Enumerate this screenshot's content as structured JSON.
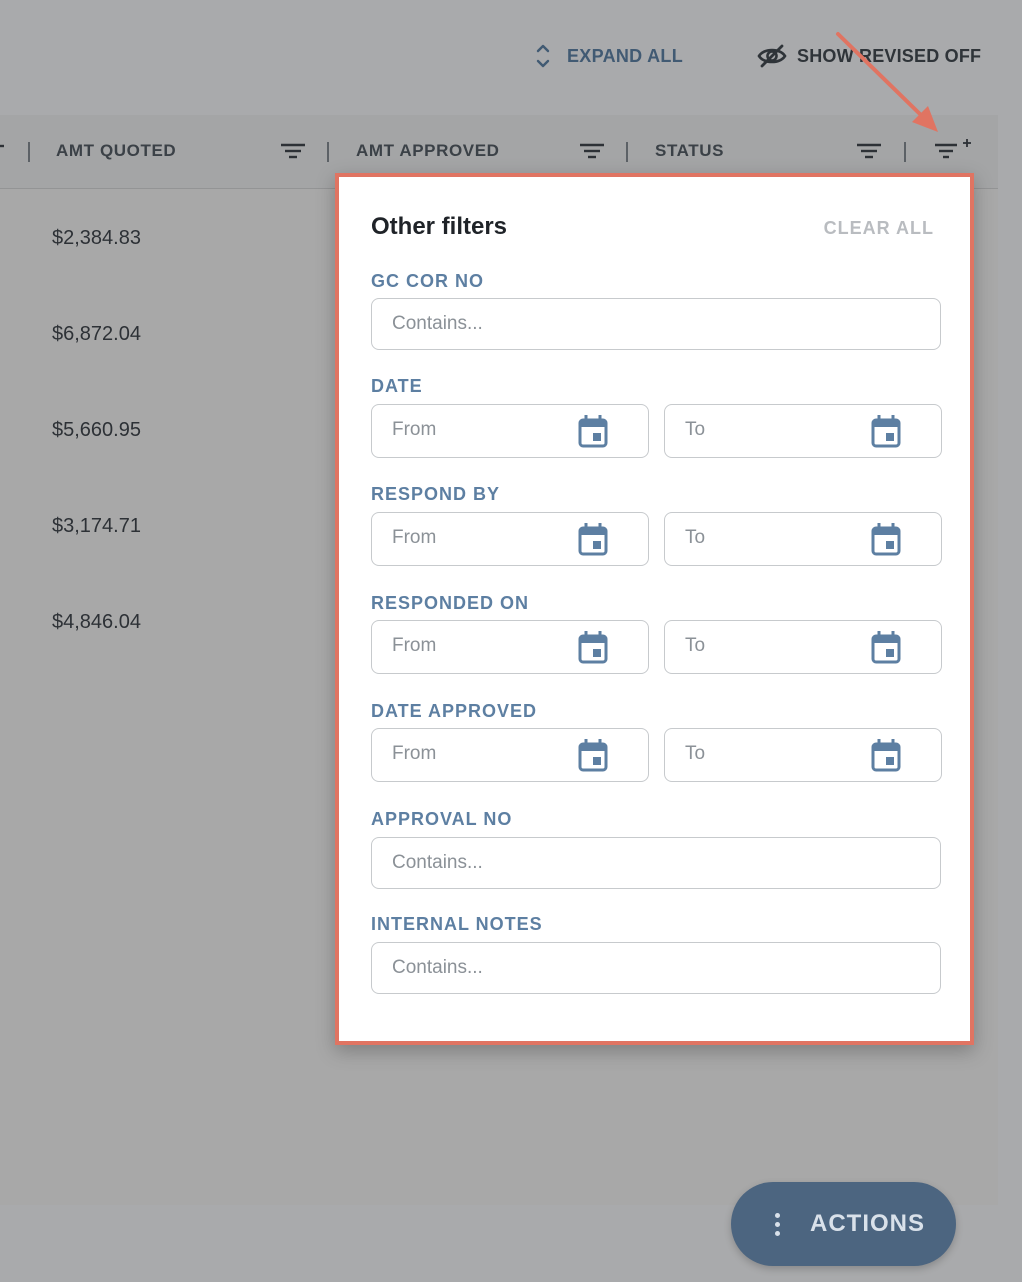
{
  "toolbar": {
    "expand_all": "EXPAND ALL",
    "show_revised": "SHOW REVISED OFF"
  },
  "table": {
    "columns": [
      "AMT QUOTED",
      "AMT APPROVED",
      "STATUS"
    ],
    "rows": [
      {
        "amt_quoted": "$2,384.83"
      },
      {
        "amt_quoted": "$6,872.04"
      },
      {
        "amt_quoted": "$5,660.95"
      },
      {
        "amt_quoted": "$3,174.71"
      },
      {
        "amt_quoted": "$4,846.04"
      }
    ]
  },
  "filters": {
    "title": "Other filters",
    "clear_all": "CLEAR ALL",
    "gc_cor_no": {
      "label": "GC COR NO",
      "placeholder": "Contains..."
    },
    "date": {
      "label": "DATE",
      "from": "From",
      "to": "To"
    },
    "respond_by": {
      "label": "RESPOND BY",
      "from": "From",
      "to": "To"
    },
    "responded_on": {
      "label": "RESPONDED ON",
      "from": "From",
      "to": "To"
    },
    "date_approved": {
      "label": "DATE APPROVED",
      "from": "From",
      "to": "To"
    },
    "approval_no": {
      "label": "APPROVAL NO",
      "placeholder": "Contains..."
    },
    "internal_notes": {
      "label": "INTERNAL NOTES",
      "placeholder": "Contains..."
    }
  },
  "actions": {
    "label": "ACTIONS"
  },
  "colors": {
    "accent": "#5d7fa2",
    "highlight_border": "#e07462",
    "actions_button": "#4c6580"
  },
  "icons": [
    "chevron-expand-icon",
    "eye-off-icon",
    "filter-icon",
    "filter-plus-icon",
    "calendar-icon",
    "more-vertical-icon",
    "arrow-annotation"
  ]
}
